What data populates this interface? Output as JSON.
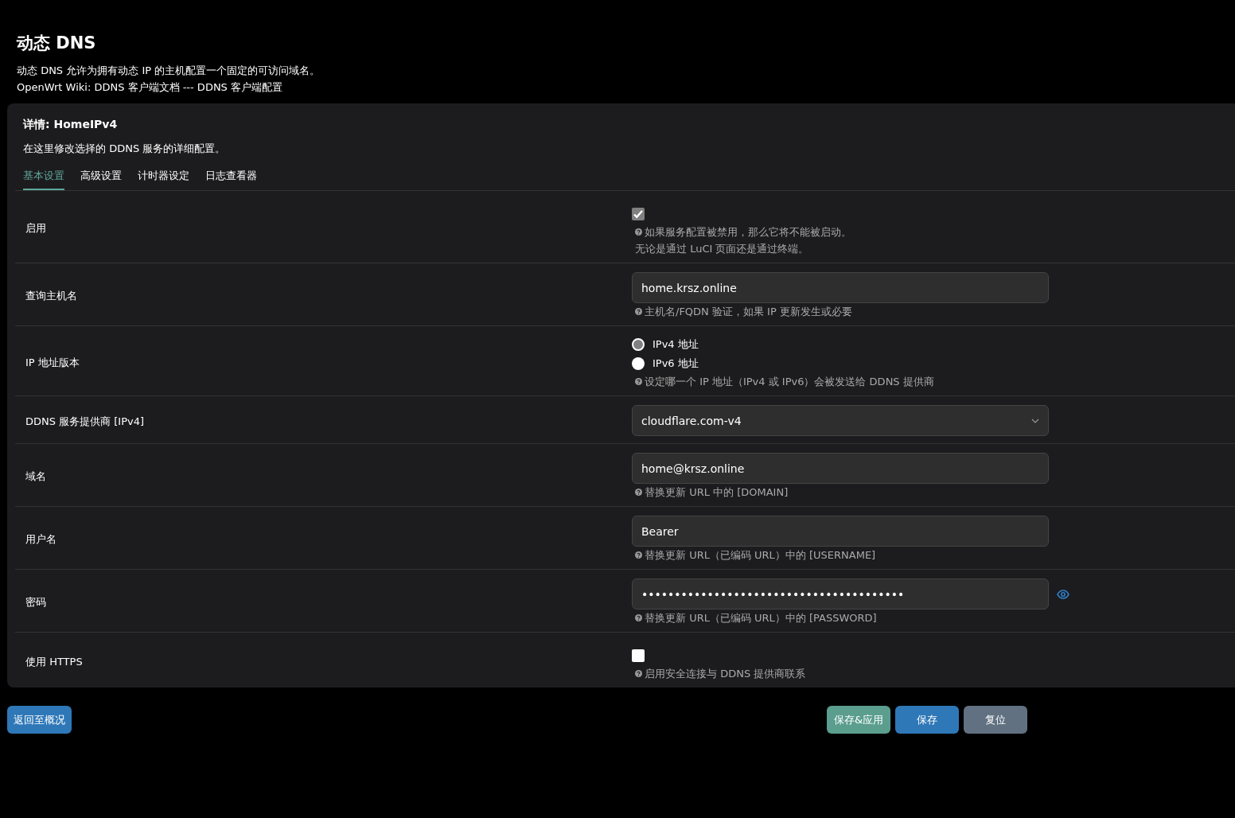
{
  "page": {
    "title": "动态 DNS",
    "description": "动态 DNS 允许为拥有动态 IP 的主机配置一个固定的可访问域名。",
    "links": "OpenWrt Wiki: DDNS 客户端文档 --- DDNS 客户端配置"
  },
  "section": {
    "title": "详情: HomeIPv4",
    "description": "在这里修改选择的 DDNS 服务的详细配置。"
  },
  "tabs": [
    {
      "label": "基本设置",
      "selected": true
    },
    {
      "label": "高级设置",
      "selected": false
    },
    {
      "label": "计时器设定",
      "selected": false
    },
    {
      "label": "日志查看器",
      "selected": false
    }
  ],
  "fields": [
    {
      "kind": "checkbox",
      "label": "启用",
      "checked": true,
      "hint": [
        "如果服务配置被禁用，那么它将不能被启动。",
        "无论是通过 LuCI 页面还是通过终端。"
      ]
    },
    {
      "kind": "text",
      "label": "查询主机名",
      "value": "home.krsz.online",
      "hint": [
        "主机名/FQDN 验证，如果 IP 更新发生或必要"
      ]
    },
    {
      "kind": "radio",
      "label": "IP 地址版本",
      "options": [
        {
          "label": "IPv4 地址",
          "selected": true
        },
        {
          "label": "IPv6 地址",
          "selected": false
        }
      ],
      "hint": [
        "设定哪一个 IP 地址（IPv4 或 IPv6）会被发送给 DDNS 提供商"
      ]
    },
    {
      "kind": "select",
      "label": "DDNS 服务提供商 [IPv4]",
      "value": "cloudflare.com-v4"
    },
    {
      "kind": "text",
      "label": "域名",
      "value": "home@krsz.online",
      "hint": [
        "替换更新 URL 中的 [DOMAIN]"
      ]
    },
    {
      "kind": "text",
      "label": "用户名",
      "value": "Bearer",
      "hint": [
        "替换更新 URL（已编码 URL）中的 [USERNAME]"
      ]
    },
    {
      "kind": "password",
      "label": "密码",
      "value": "••••••••••••••••••••••••••••••••••••••••",
      "hint": [
        "替换更新 URL（已编码 URL）中的 [PASSWORD]"
      ]
    },
    {
      "kind": "checkbox",
      "label": "使用 HTTPS",
      "checked": false,
      "hint": [
        "启用安全连接与 DDNS 提供商联系"
      ]
    }
  ],
  "footer": {
    "back_button": "返回至概况",
    "buttons": [
      {
        "kind": "apply",
        "label": "保存&应用"
      },
      {
        "kind": "save",
        "label": "保存"
      },
      {
        "kind": "reset",
        "label": "复位"
      }
    ]
  }
}
